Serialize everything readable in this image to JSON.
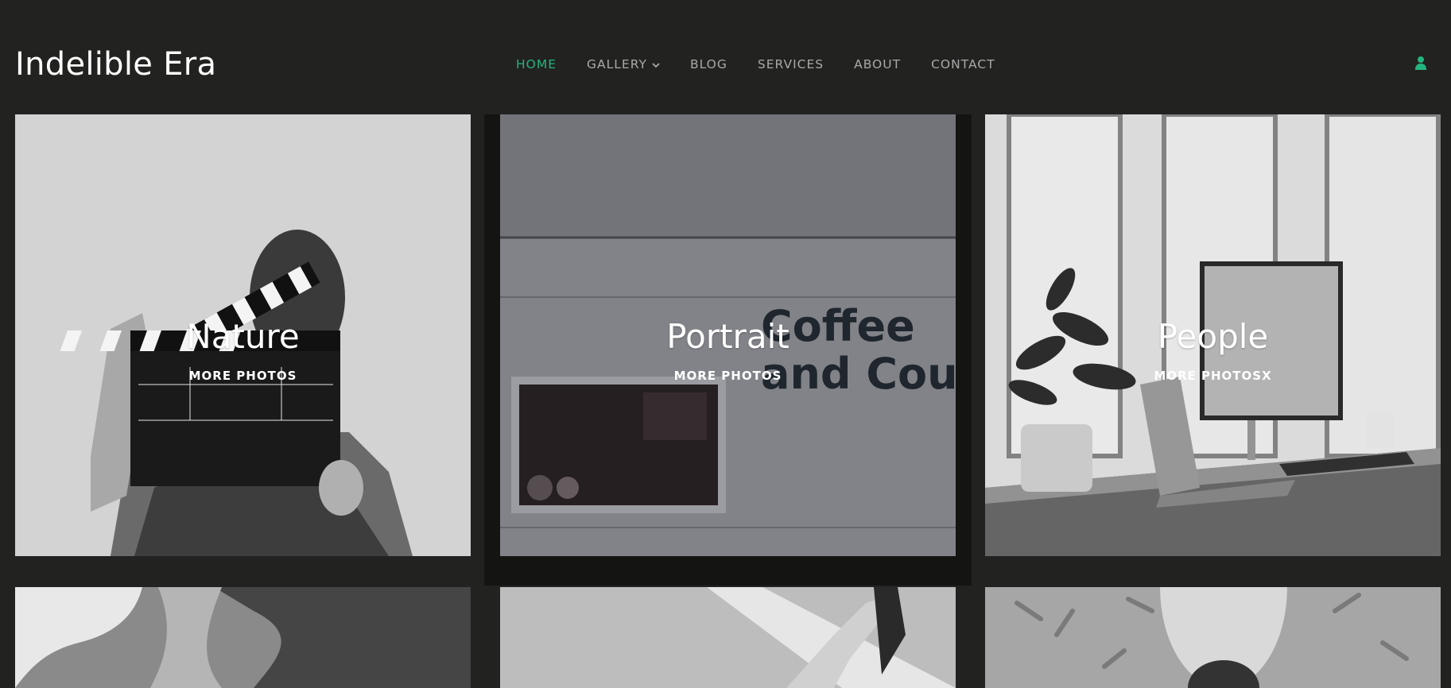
{
  "header": {
    "brand": "Indelible Era",
    "nav": {
      "home": "HOME",
      "gallery": "GALLERY",
      "blog": "BLOG",
      "services": "SERVICES",
      "about": "ABOUT",
      "contact": "CONTACT"
    },
    "accent_color": "#24b47e",
    "user_icon": "user-icon"
  },
  "gallery": {
    "tiles": [
      {
        "title": "Nature",
        "link": "MORE PHOTOS"
      },
      {
        "title": "Portrait",
        "link": "MORE PHOTOS"
      },
      {
        "title": "People",
        "link": "MORE PHOTOSX"
      }
    ]
  }
}
